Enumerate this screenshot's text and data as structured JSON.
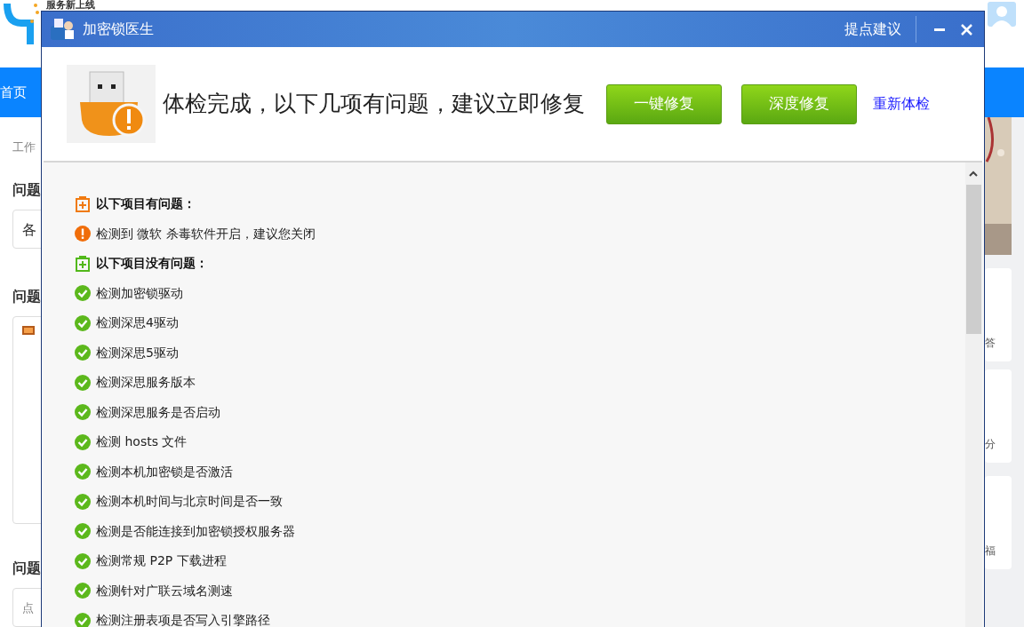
{
  "background_page": {
    "site_title": "服务新上线",
    "nav": [
      {
        "label": "首页",
        "selected": true
      }
    ],
    "breadcrumb": "工作",
    "sections": [
      {
        "label": "问题",
        "field": "各"
      },
      {
        "label": "问题"
      },
      {
        "label": "问题",
        "placeholder": "点"
      }
    ],
    "side_cards": [
      "答",
      "分",
      "福"
    ]
  },
  "dialog": {
    "title": "加密锁医生",
    "feedback": "提点建议",
    "headline": "体检完成，以下几项有问题，建议立即修复",
    "buttons": [
      "一键修复",
      "深度修复"
    ],
    "link": "重新体检",
    "groups": [
      {
        "kind": "problem",
        "heading": "以下项目有问题：",
        "items": [
          "检测到 微软 杀毒软件开启，建议您关闭"
        ]
      },
      {
        "kind": "ok",
        "heading": "以下项目没有问题：",
        "items": [
          "检测加密锁驱动",
          "检测深思4驱动",
          "检测深思5驱动",
          "检测深思服务版本",
          "检测深思服务是否启动",
          "检测 hosts 文件",
          "检测本机加密锁是否激活",
          "检测本机时间与北京时间是否一致",
          "检测是否能连接到加密锁授权服务器",
          "检测常规 P2P 下载进程",
          "检测针对广联云域名测速",
          "检测注册表项是否写入引擎路径"
        ]
      }
    ]
  }
}
